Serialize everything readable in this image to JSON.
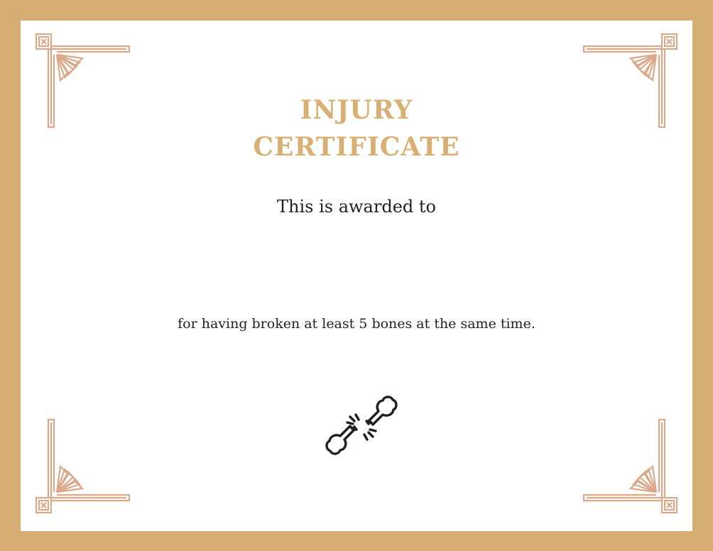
{
  "certificate": {
    "title_line1": "INJURY",
    "title_line2": "CERTIFICATE",
    "awarded_text": "This is awarded to",
    "recipient_name": "",
    "reason_text": "for having broken at least 5 bones at the same time.",
    "icon": "broken-bone-icon",
    "ornament": "art-deco-corner-ornament"
  },
  "colors": {
    "border": "#d6ae74",
    "title": "#d8b073",
    "ornament": "#d9a98a",
    "text": "#222222",
    "paper": "#ffffff"
  }
}
